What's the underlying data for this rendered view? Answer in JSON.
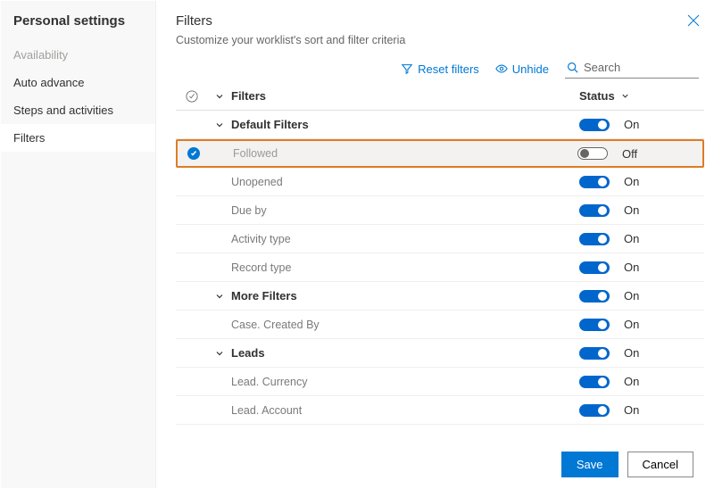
{
  "sidebar": {
    "title": "Personal settings",
    "items": [
      {
        "label": "Availability",
        "disabled": true
      },
      {
        "label": "Auto advance"
      },
      {
        "label": "Steps and activities"
      },
      {
        "label": "Filters",
        "active": true
      }
    ]
  },
  "header": {
    "title": "Filters",
    "subtitle": "Customize your worklist's sort and filter criteria"
  },
  "toolbar": {
    "reset": "Reset filters",
    "unhide": "Unhide",
    "search_placeholder": "Search"
  },
  "columns": {
    "name": "Filters",
    "status": "Status"
  },
  "status_labels": {
    "on": "On",
    "off": "Off"
  },
  "rows": [
    {
      "type": "group",
      "label": "Default Filters",
      "status": "on"
    },
    {
      "type": "leaf",
      "label": "Followed",
      "status": "off",
      "selected": true,
      "highlight": true
    },
    {
      "type": "leaf",
      "label": "Unopened",
      "status": "on"
    },
    {
      "type": "leaf",
      "label": "Due by",
      "status": "on"
    },
    {
      "type": "leaf",
      "label": "Activity type",
      "status": "on"
    },
    {
      "type": "leaf",
      "label": "Record type",
      "status": "on"
    },
    {
      "type": "group",
      "label": "More Filters",
      "status": "on"
    },
    {
      "type": "leaf",
      "label": "Case. Created By",
      "status": "on"
    },
    {
      "type": "group",
      "label": "Leads",
      "status": "on"
    },
    {
      "type": "leaf",
      "label": "Lead. Currency",
      "status": "on"
    },
    {
      "type": "leaf",
      "label": "Lead. Account",
      "status": "on"
    }
  ],
  "footer": {
    "save": "Save",
    "cancel": "Cancel"
  }
}
